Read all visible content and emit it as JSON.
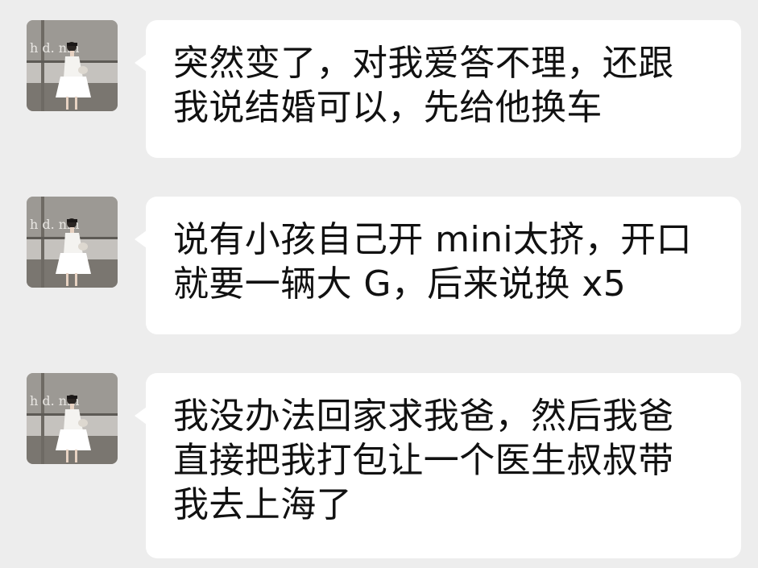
{
  "chat": {
    "messages": [
      {
        "sender_avatar": "girl-white-dress-photo",
        "text": "突然变了，对我爱答不理，还跟\n我说结婚可以，先给他换车"
      },
      {
        "sender_avatar": "girl-white-dress-photo",
        "text": "说有小孩自己开 mini太挤，开口\n就要一辆大 G，后来说换 x5"
      },
      {
        "sender_avatar": "girl-white-dress-photo",
        "text": "我没办法回家求我爸，然后我爸\n直接把我打包让一个医生叔叔带\n我去上海了"
      }
    ],
    "colors": {
      "background": "#ededed",
      "bubble": "#ffffff",
      "text": "#111111"
    }
  }
}
